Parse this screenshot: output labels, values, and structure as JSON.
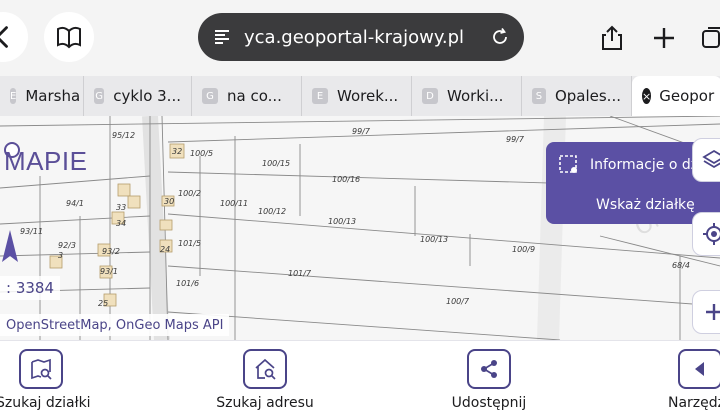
{
  "browser": {
    "url": "yca.geoportal-krajowy.pl",
    "tabs": [
      {
        "favicon": "E",
        "label": "Marsha"
      },
      {
        "favicon": "G",
        "label": "cyklo 3..."
      },
      {
        "favicon": "G",
        "label": "na co..."
      },
      {
        "favicon": "E",
        "label": "Worek..."
      },
      {
        "favicon": "D",
        "label": "Worki..."
      },
      {
        "favicon": "S",
        "label": "Opales..."
      },
      {
        "favicon": "×",
        "label": "Geopor"
      }
    ]
  },
  "map": {
    "logo": "MAPIE",
    "scale": ": 3384",
    "attribution": "OpenStreetMap, OnGeo Maps API",
    "info_panel": {
      "title": "Informacje o dz",
      "action": "Wskaż działkę"
    },
    "parcel_labels": [
      "95/12",
      "99/7",
      "99/7",
      "32",
      "100/5",
      "100/15",
      "100/16",
      "94/1",
      "100/2",
      "100/11",
      "100/12",
      "33",
      "30",
      "100/13",
      "100/13",
      "100/9",
      "93/11",
      "34",
      "92/3",
      "93/2",
      "24",
      "101/5",
      "3",
      "101/6",
      "101/7",
      "25",
      "100/7",
      "68/4",
      "93/1"
    ],
    "watermark": "OnGeo"
  },
  "toolbar": {
    "items": [
      {
        "label": "Szukaj działki"
      },
      {
        "label": "Szukaj adresu"
      },
      {
        "label": "Udostępnij"
      },
      {
        "label": "Narzędzia"
      }
    ]
  },
  "colors": {
    "accent": "#5b50a4",
    "dark_accent": "#4a4488",
    "url_bg": "#3b3b3d"
  }
}
